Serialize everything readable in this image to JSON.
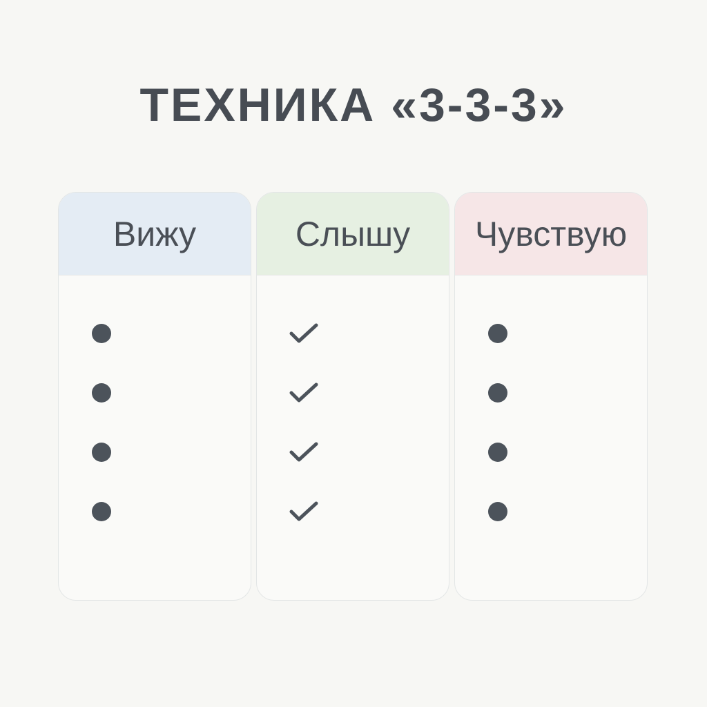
{
  "title": "ТЕХНИКА «3-3-3»",
  "columns": [
    {
      "label": "Вижу",
      "color": "#e4ecf4",
      "marker": "bullet-dot-icon",
      "items": 4
    },
    {
      "label": "Слышу",
      "color": "#e6f0e2",
      "marker": "checkmark-icon",
      "items": 4
    },
    {
      "label": "Чувствую",
      "color": "#f6e6e7",
      "marker": "bullet-dot-icon",
      "items": 4
    }
  ],
  "colors": {
    "background": "#f7f7f4",
    "text": "#474c53",
    "marker": "#4c535b"
  }
}
